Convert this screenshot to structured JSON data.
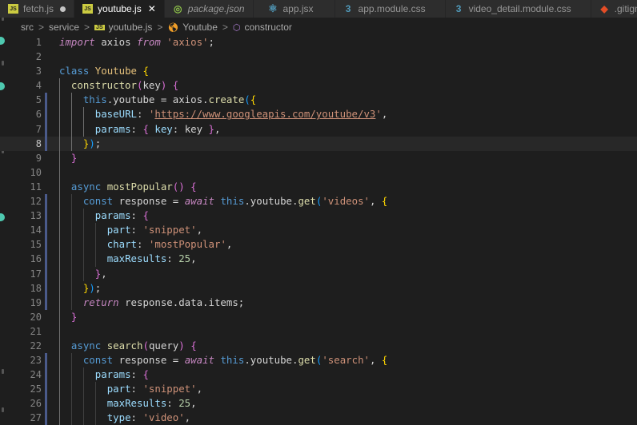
{
  "tabs": [
    {
      "label": "fetch.js",
      "icon": "js-file-icon",
      "state": "dirty"
    },
    {
      "label": "youtube.js",
      "icon": "js-file-icon",
      "state": "active"
    },
    {
      "label": "package.json",
      "icon": "package-json-icon",
      "state": "preview"
    },
    {
      "label": "app.jsx",
      "icon": "react-file-icon",
      "state": "normal"
    },
    {
      "label": "app.module.css",
      "icon": "css-file-icon",
      "state": "normal"
    },
    {
      "label": "video_detail.module.css",
      "icon": "css-file-icon",
      "state": "normal"
    },
    {
      "label": ".gitignore",
      "icon": "git-file-icon",
      "state": "normal"
    }
  ],
  "tab_icon_glyphs": {
    "js": "JS",
    "pkg": "◎",
    "react": "⚛",
    "css": "3",
    "git": "◆",
    "close": "✕"
  },
  "breadcrumb": {
    "items": [
      "src",
      "service",
      "youtube.js",
      "Youtube",
      "constructor"
    ],
    "separator": ">"
  },
  "editor": {
    "current_line": 8,
    "line_numbers": [
      "1",
      "2",
      "3",
      "4",
      "5",
      "6",
      "7",
      "8",
      "9",
      "10",
      "11",
      "12",
      "13",
      "14",
      "15",
      "16",
      "17",
      "18",
      "19",
      "20",
      "21",
      "22",
      "23",
      "24",
      "25",
      "26",
      "27"
    ],
    "lines": [
      [
        [
          "kw it",
          "import"
        ],
        [
          "plain",
          " axios "
        ],
        [
          "kw it",
          "from"
        ],
        [
          "plain",
          " "
        ],
        [
          "str",
          "'axios'"
        ],
        [
          "plain",
          ";"
        ]
      ],
      [],
      [
        [
          "kw2",
          "class"
        ],
        [
          "plain",
          " "
        ],
        [
          "cls-decl",
          "Youtube"
        ],
        [
          "plain",
          " "
        ],
        [
          "b1",
          "{"
        ]
      ],
      [
        [
          "plain",
          "  "
        ],
        [
          "fn",
          "constructor"
        ],
        [
          "b2",
          "("
        ],
        [
          "plain",
          "key"
        ],
        [
          "b2",
          ")"
        ],
        [
          "plain",
          " "
        ],
        [
          "b2",
          "{"
        ]
      ],
      [
        [
          "plain",
          "    "
        ],
        [
          "this",
          "this"
        ],
        [
          "plain",
          "."
        ],
        [
          "plain",
          "youtube = axios."
        ],
        [
          "fn",
          "create"
        ],
        [
          "b3",
          "("
        ],
        [
          "b1",
          "{"
        ]
      ],
      [
        [
          "plain",
          "      "
        ],
        [
          "prop",
          "baseURL"
        ],
        [
          "plain",
          ": "
        ],
        [
          "str",
          "'"
        ],
        [
          "url",
          "https://www.googleapis.com/youtube/v3"
        ],
        [
          "str",
          "'"
        ],
        [
          "plain",
          ","
        ]
      ],
      [
        [
          "plain",
          "      "
        ],
        [
          "prop",
          "params"
        ],
        [
          "plain",
          ": "
        ],
        [
          "b2",
          "{"
        ],
        [
          "plain",
          " "
        ],
        [
          "prop",
          "key"
        ],
        [
          "plain",
          ": key "
        ],
        [
          "b2",
          "}"
        ],
        [
          "plain",
          ","
        ]
      ],
      [
        [
          "plain",
          "    "
        ],
        [
          "b1",
          "}"
        ],
        [
          "b3",
          ")"
        ],
        [
          "plain",
          ";"
        ]
      ],
      [
        [
          "plain",
          "  "
        ],
        [
          "b2",
          "}"
        ]
      ],
      [],
      [
        [
          "plain",
          "  "
        ],
        [
          "kw2",
          "async"
        ],
        [
          "plain",
          " "
        ],
        [
          "fn",
          "mostPopular"
        ],
        [
          "b2",
          "("
        ],
        [
          "b2",
          ")"
        ],
        [
          "plain",
          " "
        ],
        [
          "b2",
          "{"
        ]
      ],
      [
        [
          "plain",
          "    "
        ],
        [
          "kw2",
          "const"
        ],
        [
          "plain",
          " response = "
        ],
        [
          "it",
          "await"
        ],
        [
          "plain",
          " "
        ],
        [
          "this",
          "this"
        ],
        [
          "plain",
          ".youtube."
        ],
        [
          "fn",
          "get"
        ],
        [
          "b3",
          "("
        ],
        [
          "str",
          "'videos'"
        ],
        [
          "plain",
          ", "
        ],
        [
          "b1",
          "{"
        ]
      ],
      [
        [
          "plain",
          "      "
        ],
        [
          "prop",
          "params"
        ],
        [
          "plain",
          ": "
        ],
        [
          "b2",
          "{"
        ]
      ],
      [
        [
          "plain",
          "        "
        ],
        [
          "prop",
          "part"
        ],
        [
          "plain",
          ": "
        ],
        [
          "str",
          "'snippet'"
        ],
        [
          "plain",
          ","
        ]
      ],
      [
        [
          "plain",
          "        "
        ],
        [
          "prop",
          "chart"
        ],
        [
          "plain",
          ": "
        ],
        [
          "str",
          "'mostPopular'"
        ],
        [
          "plain",
          ","
        ]
      ],
      [
        [
          "plain",
          "        "
        ],
        [
          "prop",
          "maxResults"
        ],
        [
          "plain",
          ": "
        ],
        [
          "num",
          "25"
        ],
        [
          "plain",
          ","
        ]
      ],
      [
        [
          "plain",
          "      "
        ],
        [
          "b2",
          "}"
        ],
        [
          "plain",
          ","
        ]
      ],
      [
        [
          "plain",
          "    "
        ],
        [
          "b1",
          "}"
        ],
        [
          "b3",
          ")"
        ],
        [
          "plain",
          ";"
        ]
      ],
      [
        [
          "plain",
          "    "
        ],
        [
          "it",
          "return"
        ],
        [
          "plain",
          " response.data.items;"
        ]
      ],
      [
        [
          "plain",
          "  "
        ],
        [
          "b2",
          "}"
        ]
      ],
      [],
      [
        [
          "plain",
          "  "
        ],
        [
          "kw2",
          "async"
        ],
        [
          "plain",
          " "
        ],
        [
          "fn",
          "search"
        ],
        [
          "b2",
          "("
        ],
        [
          "plain",
          "query"
        ],
        [
          "b2",
          ")"
        ],
        [
          "plain",
          " "
        ],
        [
          "b2",
          "{"
        ]
      ],
      [
        [
          "plain",
          "    "
        ],
        [
          "kw2",
          "const"
        ],
        [
          "plain",
          " response = "
        ],
        [
          "it",
          "await"
        ],
        [
          "plain",
          " "
        ],
        [
          "this",
          "this"
        ],
        [
          "plain",
          ".youtube."
        ],
        [
          "fn",
          "get"
        ],
        [
          "b3",
          "("
        ],
        [
          "str",
          "'search'"
        ],
        [
          "plain",
          ", "
        ],
        [
          "b1",
          "{"
        ]
      ],
      [
        [
          "plain",
          "      "
        ],
        [
          "prop",
          "params"
        ],
        [
          "plain",
          ": "
        ],
        [
          "b2",
          "{"
        ]
      ],
      [
        [
          "plain",
          "        "
        ],
        [
          "prop",
          "part"
        ],
        [
          "plain",
          ": "
        ],
        [
          "str",
          "'snippet'"
        ],
        [
          "plain",
          ","
        ]
      ],
      [
        [
          "plain",
          "        "
        ],
        [
          "prop",
          "maxResults"
        ],
        [
          "plain",
          ": "
        ],
        [
          "num",
          "25"
        ],
        [
          "plain",
          ","
        ]
      ],
      [
        [
          "plain",
          "        "
        ],
        [
          "prop",
          "type"
        ],
        [
          "plain",
          ": "
        ],
        [
          "str",
          "'video'"
        ],
        [
          "plain",
          ","
        ]
      ]
    ]
  },
  "colors": {
    "background": "#1e1e1e",
    "tabbar": "#252526",
    "accent_teal": "#4ec9b0",
    "line_number": "#858585"
  }
}
